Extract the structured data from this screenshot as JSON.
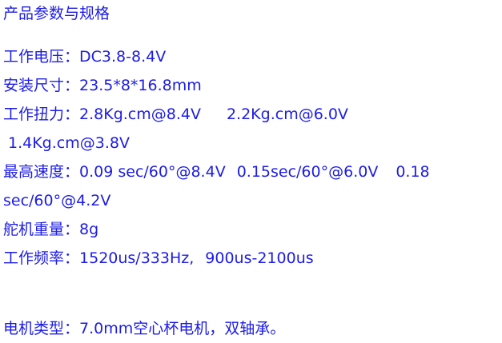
{
  "title": "产品参数与规格",
  "specs": {
    "voltage": {
      "label": "工作电压：",
      "value": "DC3.8-8.4V"
    },
    "size": {
      "label": "安装尺寸：",
      "value": "23.5*8*16.8mm"
    },
    "torque": {
      "label": "工作扭力：",
      "v1": "2.8Kg.cm@8.4V",
      "v2": "2.2Kg.cm@6.0V",
      "v3": "1.4Kg.cm@3.8V"
    },
    "speed": {
      "label": "最高速度：",
      "v1": "0.09 sec/60°@8.4V",
      "v2": "0.15sec/60°@6.0V",
      "v3a": "0.18",
      "v3b": "sec/60°@4.2V"
    },
    "weight": {
      "label": "舵机重量：",
      "value": "8g"
    },
    "frequency": {
      "label": "工作频率：",
      "v1": "1520us/333Hz,",
      "v2": "900us-2100us"
    },
    "motor": {
      "label": "电机类型：",
      "value": "7.0mm空心杯电机，双轴承。"
    }
  },
  "colors": {
    "text": "#1c1ce6",
    "background": "#ffffff"
  }
}
